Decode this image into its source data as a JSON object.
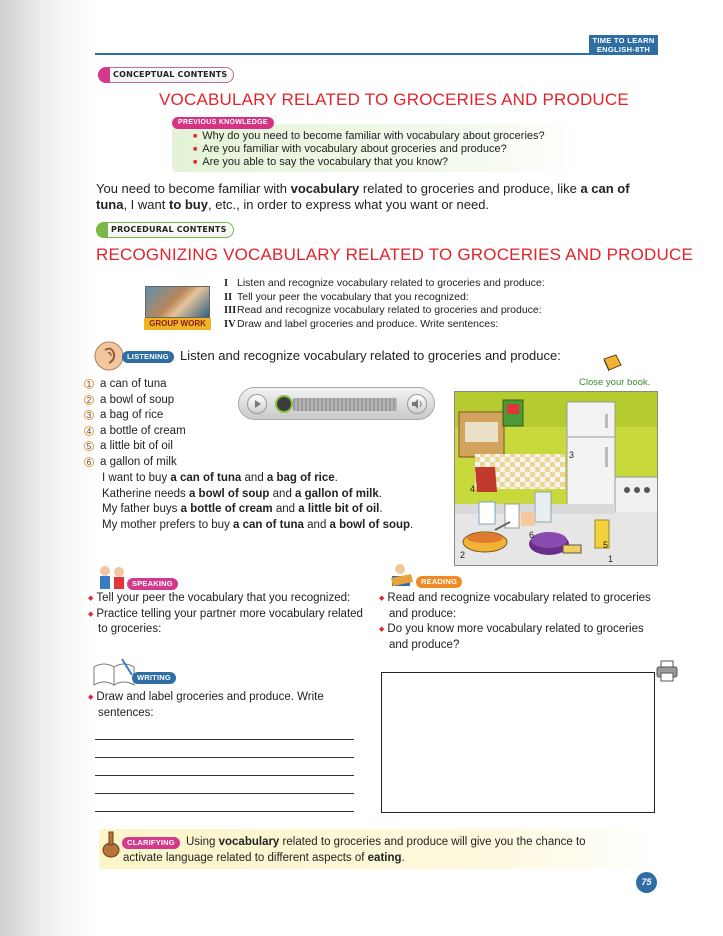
{
  "header": {
    "tab_line1": "TIME TO LEARN",
    "tab_line2": "ENGLISH-8TH"
  },
  "conceptual": {
    "label": "CONCEPTUAL CONTENTS",
    "title": "VOCABULARY RELATED TO GROCERIES AND PRODUCE",
    "pk_label": "PREVIOUS KNOWLEDGE",
    "questions": [
      "Why do you need to become familiar with vocabulary about groceries?",
      "Are you familiar with vocabulary about groceries and produce?",
      "Are you able to say the vocabulary that you know?"
    ],
    "intro": {
      "t1": "You need to become familiar with ",
      "b1": "vocabulary",
      "t2": " related to groceries and produce, like ",
      "b2": "a can of tuna",
      "t3": ", I want ",
      "b3": "to buy",
      "t4": ", etc., in order to express what you want or need."
    }
  },
  "procedural": {
    "label": "PROCEDURAL CONTENTS",
    "title": "RECOGNIZING VOCABULARY RELATED TO GROCERIES AND PRODUCE",
    "group_label": "GROUP WORK",
    "steps": [
      {
        "num": "I",
        "text": "Listen and recognize vocabulary related to groceries and produce:"
      },
      {
        "num": "II",
        "text": "Tell your peer the vocabulary that you recognized:"
      },
      {
        "num": "III",
        "text": "Read and recognize vocabulary related to groceries and produce:"
      },
      {
        "num": "IV",
        "text": "Draw and label groceries and produce. Write sentences:"
      }
    ]
  },
  "listening": {
    "tag": "LISTENING",
    "instruction": "Listen and recognize vocabulary related to groceries and produce:",
    "close_book": "Close your book.",
    "items": [
      {
        "num": "1",
        "text": "a can of tuna"
      },
      {
        "num": "2",
        "text": "a bowl of soup"
      },
      {
        "num": "3",
        "text": "a bag of rice"
      },
      {
        "num": "4",
        "text": "a bottle of cream"
      },
      {
        "num": "5",
        "text": "a little bit of oil"
      },
      {
        "num": "6",
        "text": "a gallon of milk"
      }
    ],
    "sentences": [
      {
        "a": "I want to buy ",
        "b": "a can of tuna",
        "c": " and ",
        "d": "a bag of rice",
        "e": "."
      },
      {
        "a": "Katherine needs ",
        "b": "a bowl of soup",
        "c": " and ",
        "d": "a gallon of milk",
        "e": "."
      },
      {
        "a": "My father buys ",
        "b": "a bottle of cream",
        "c": " and ",
        "d": "a little bit of oil",
        "e": "."
      },
      {
        "a": "My mother prefers to buy ",
        "b": "a can of tuna",
        "c": " and ",
        "d": "a bowl of soup",
        "e": "."
      }
    ],
    "picture_numbers": [
      "1",
      "2",
      "3",
      "4",
      "5",
      "6"
    ]
  },
  "speaking": {
    "tag": "SPEAKING",
    "items": [
      "Tell your peer the vocabulary that you recognized:",
      "Practice telling your partner more vocabulary related to groceries:"
    ]
  },
  "reading": {
    "tag": "READING",
    "items": [
      "Read and recognize vocabulary related to groceries and produce:",
      "Do you know more vocabulary related to groceries and produce?"
    ]
  },
  "writing": {
    "tag": "WRITING",
    "instruction": "Draw and label groceries and produce. Write sentences:"
  },
  "clarifying": {
    "tag": "CLARIFYING",
    "t1": "Using ",
    "b1": "vocabulary",
    "t2": " related to groceries and produce will give you the chance to",
    "t3": "activate language related to different aspects of ",
    "b2": "eating",
    "t4": "."
  },
  "page_number": "75",
  "colors": {
    "accent_red": "#e3232c",
    "accent_blue": "#2e6ea3",
    "green": "#7ab648",
    "magenta": "#d33a8c"
  },
  "icons": [
    "book-icon",
    "printer-icon",
    "ear-icon",
    "play-icon",
    "speaker-icon",
    "spoon-icon"
  ]
}
